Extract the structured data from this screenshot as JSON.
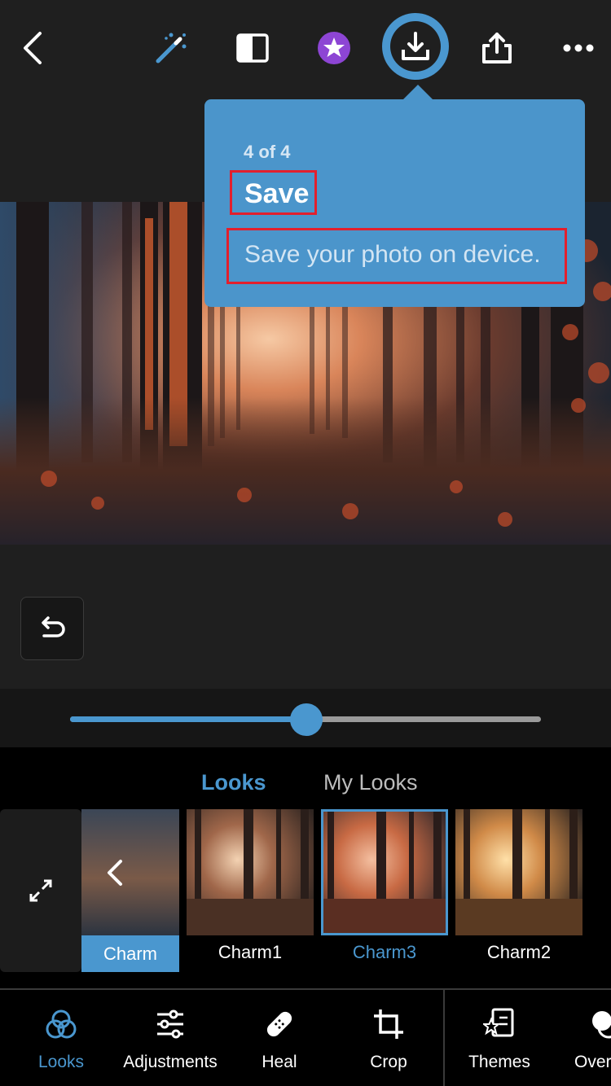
{
  "toolbar": {
    "back_icon": "chevron-left-icon",
    "auto_icon": "magic-wand-icon",
    "compare_icon": "before-after-icon",
    "premium_icon": "star-badge-icon",
    "save_icon": "download-icon",
    "share_icon": "share-icon",
    "more_icon": "ellipsis-icon"
  },
  "tooltip": {
    "step": "4 of 4",
    "title": "Save",
    "description": "Save your photo on device."
  },
  "slider": {
    "value": 0.502
  },
  "looks_panel": {
    "tabs": [
      {
        "label": "Looks",
        "active": true
      },
      {
        "label": "My Looks",
        "active": false
      }
    ],
    "items": [
      {
        "label": "Charm",
        "kind": "category"
      },
      {
        "label": "Charm1"
      },
      {
        "label": "Charm3",
        "selected": true
      },
      {
        "label": "Charm2"
      }
    ]
  },
  "bottom_nav": [
    {
      "label": "Looks",
      "icon": "looks-icon",
      "active": true
    },
    {
      "label": "Adjustments",
      "icon": "sliders-icon"
    },
    {
      "label": "Heal",
      "icon": "bandage-icon"
    },
    {
      "label": "Crop",
      "icon": "crop-icon"
    },
    {
      "label": "Themes",
      "icon": "themes-icon"
    },
    {
      "label": "Over",
      "icon": "overlay-icon"
    }
  ],
  "colors": {
    "accent": "#4a97cf",
    "highlight_border": "#e31f2d",
    "background": "#1f1f1f"
  }
}
